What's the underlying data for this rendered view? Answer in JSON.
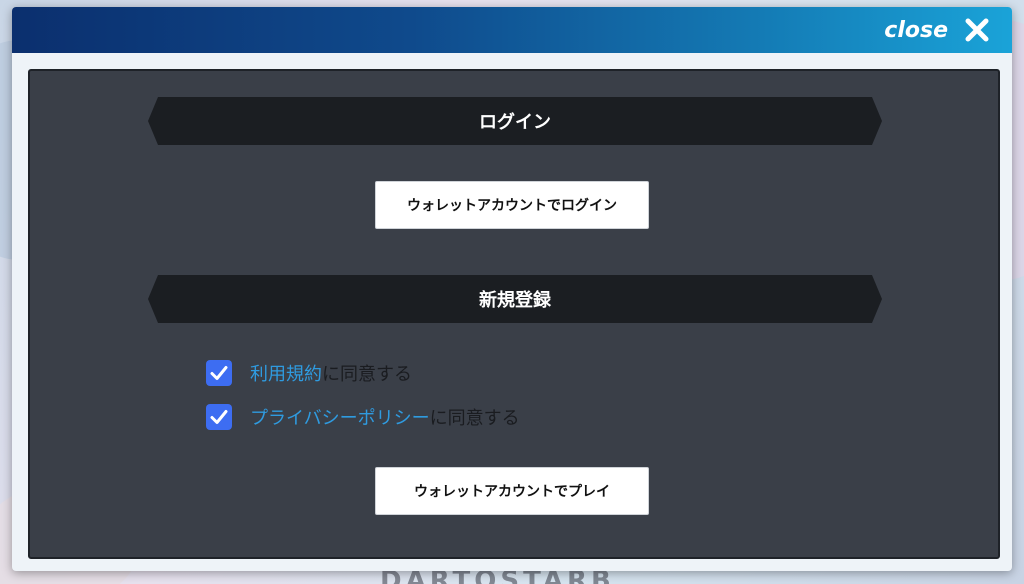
{
  "background": {
    "partial_text": "DARTOSTARB"
  },
  "header": {
    "close_label": "close",
    "close_icon": "close-x-icon"
  },
  "login_section": {
    "title": "ログイン",
    "wallet_login_button": "ウォレットアカウントでログイン"
  },
  "register_section": {
    "title": "新規登録",
    "terms": {
      "checked": true,
      "link_text": "利用規約",
      "suffix": "に同意する"
    },
    "privacy": {
      "checked": true,
      "link_text": "プライバシーポリシー",
      "suffix": "に同意する"
    },
    "wallet_play_button": "ウォレットアカウントでプレイ"
  },
  "colors": {
    "header_gradient_start": "#0b2f6e",
    "header_gradient_end": "#1aa3d8",
    "panel": "#3a3f48",
    "section_banner": "#1b1e22",
    "checkbox": "#3d6df2",
    "link": "#2f9be0"
  }
}
